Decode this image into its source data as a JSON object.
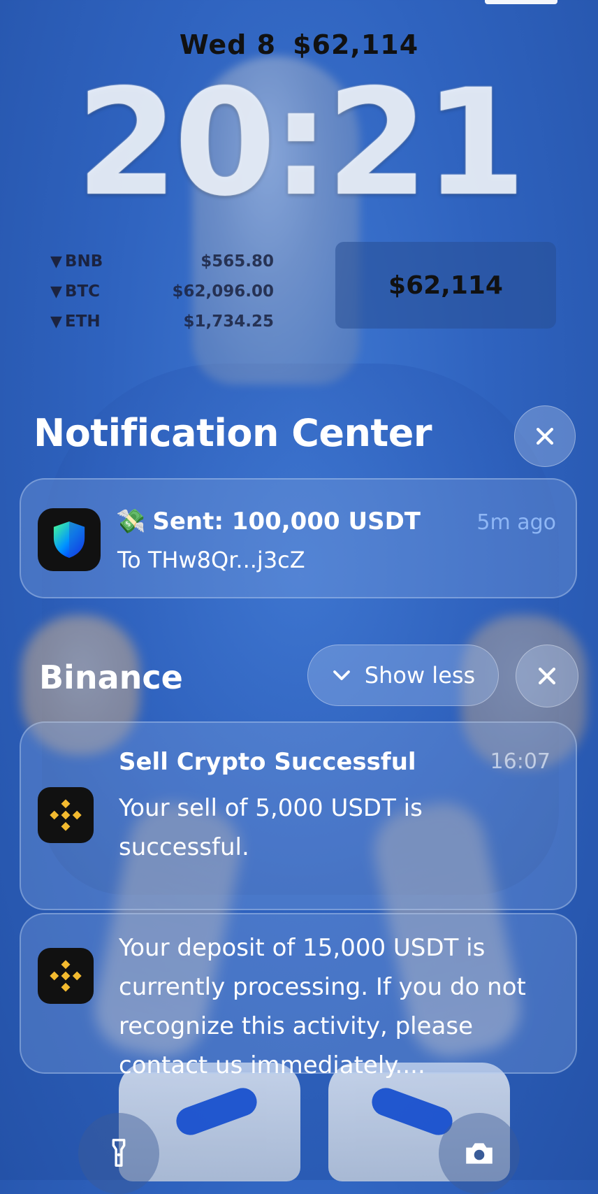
{
  "lockscreen": {
    "date": "Wed 8",
    "header_price": "$62,114",
    "time": "20:21"
  },
  "ticker": [
    {
      "symbol": "BNB",
      "price": "$565.80"
    },
    {
      "symbol": "BTC",
      "price": "$62,096.00"
    },
    {
      "symbol": "ETH",
      "price": "$1,734.25"
    }
  ],
  "price_widget": {
    "value": "$62,114"
  },
  "notification_center": {
    "title": "Notification Center",
    "close_icon": "close-icon"
  },
  "trust_notification": {
    "app_icon": "shield-icon",
    "emoji": "💸",
    "title": "Sent: 100,000 USDT",
    "time": "5m ago",
    "subtitle": "To THw8Qr...j3cZ"
  },
  "binance_group": {
    "title": "Binance",
    "show_less_label": "Show less",
    "notifications": [
      {
        "title": "Sell Crypto Successful",
        "time": "16:07",
        "body": "Your sell of 5,000 USDT is successful."
      },
      {
        "body": "Your deposit of 15,000 USDT is currently processing. If you do not recognize this activity, please contact us immediately...."
      }
    ]
  },
  "colors": {
    "background": "#2f63bf",
    "accent_time": "#8fb7f5",
    "binance_yellow": "#f3ba2f"
  },
  "quick_actions": {
    "left_icon": "flashlight-icon",
    "right_icon": "camera-icon"
  }
}
